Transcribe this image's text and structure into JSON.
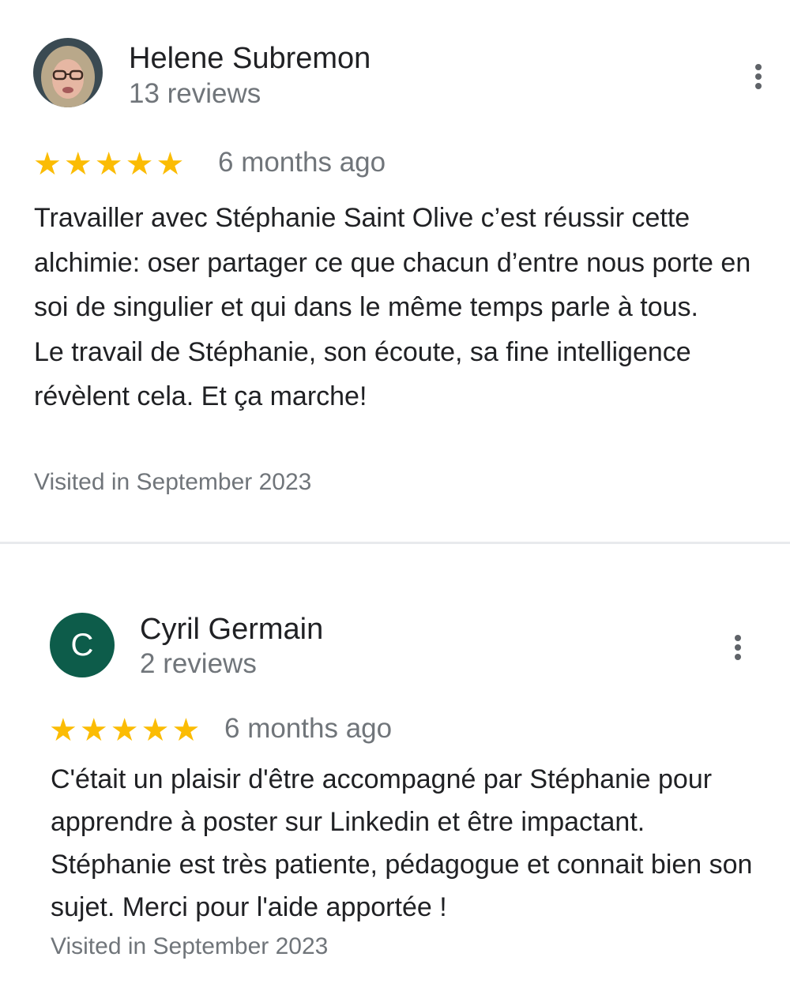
{
  "reviews": [
    {
      "author": "Helene Subremon",
      "review_count": "13 reviews",
      "avatar": "profile-photo",
      "rating": 5,
      "date": "6 months ago",
      "text": "Travailler avec Stéphanie Saint Olive c’est réussir cette alchimie: oser partager ce que chacun d’entre nous porte en soi de singulier et qui dans le même temps parle à tous.\nLe travail de Stéphanie, son écoute, sa fine intelligence révèlent cela. Et ça marche!",
      "visited": "Visited in September 2023"
    },
    {
      "author": "Cyril Germain",
      "review_count": "2 reviews",
      "avatar_letter": "C",
      "avatar_color": "#0d5c4a",
      "rating": 5,
      "date": "6 months ago",
      "text": "C'était un plaisir d'être accompagné par Stéphanie pour apprendre à poster sur Linkedin et être impactant. Stéphanie est très patiente, pédagogue et connait bien son sujet. Merci pour l'aide apportée !",
      "visited": "Visited in September 2023"
    }
  ],
  "colors": {
    "star": "#fbbc04",
    "secondary_text": "#70757a",
    "primary_text": "#202124",
    "divider": "#e8eaed"
  },
  "icons": {
    "more": "more-vertical-icon",
    "star": "star-icon"
  }
}
